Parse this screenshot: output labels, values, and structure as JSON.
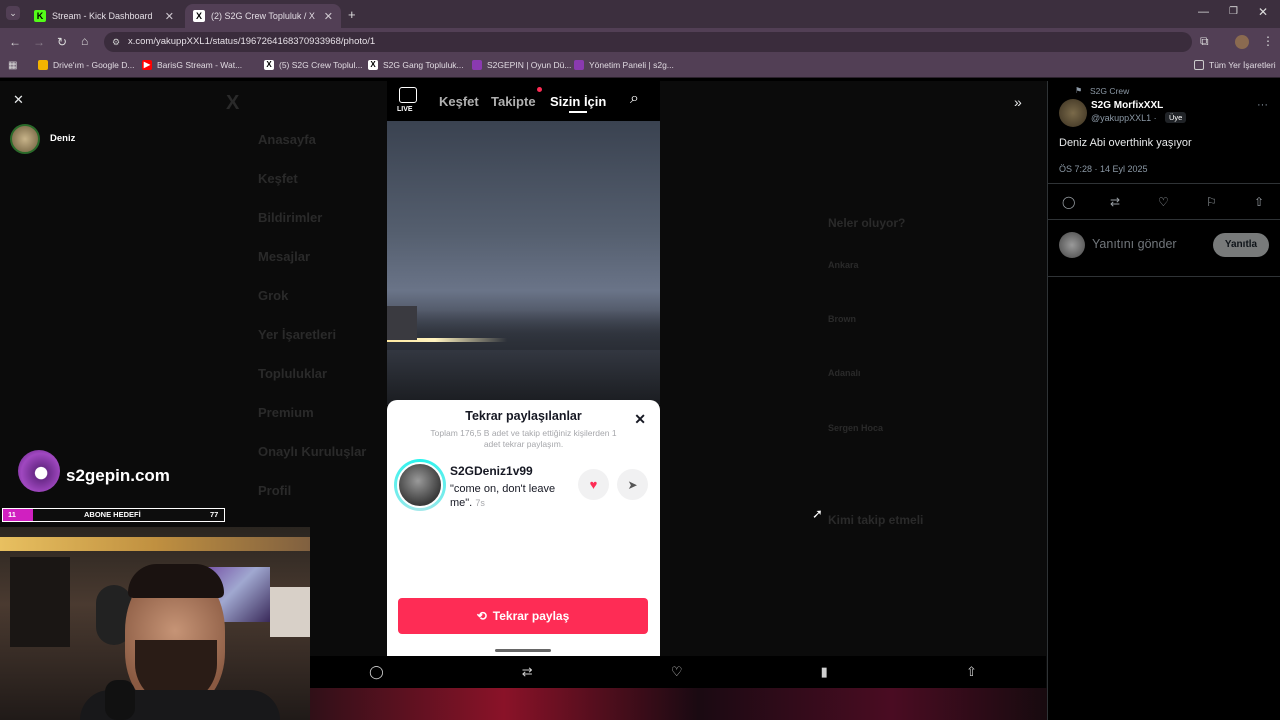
{
  "browser": {
    "tabs": [
      {
        "title": "Stream - Kick Dashboard",
        "favicon": "K"
      },
      {
        "title": "(2) S2G Crew Topluluk / X",
        "favicon": "X"
      }
    ],
    "url": "x.com/yakuppXXL1/status/1967264168370933968/photo/1",
    "bookmarks": [
      "Drive'ım - Google D...",
      "BarisG Stream - Wat...",
      "(5) S2G Crew Toplul...",
      "S2G Gang Topluluk...",
      "S2GEPIN | Oyun Dü...",
      "Yönetim Paneli | s2g..."
    ],
    "all_bookmarks": "Tüm Yer İşaretleri"
  },
  "left_panel": {
    "user_name": "Deniz"
  },
  "ghost_nav": [
    "Anasayfa",
    "Keşfet",
    "Bildirimler",
    "Mesajlar",
    "Grok",
    "Yer İşaretleri",
    "Topluluklar",
    "Premium",
    "Onaylı Kuruluşlar",
    "Profil"
  ],
  "ghost_right": {
    "trends_title": "Neler oluyor?",
    "trends": [
      "Ankara",
      "Brown",
      "Adanalı",
      "Sergen Hoca"
    ],
    "follow_title": "Kimi takip etmeli"
  },
  "tiktok": {
    "nav": {
      "live": "LIVE",
      "explore": "Keşfet",
      "following": "Takipte",
      "for_you": "Sizin İçin"
    },
    "sheet": {
      "title": "Tekrar paylaşılanlar",
      "subtitle": "Toplam 176,5 B adet ve takip ettiğiniz kişilerden 1 adet tekrar paylaşım.",
      "username": "S2GDeniz1v99",
      "quote": "\"come on, don't leave me\".",
      "time": "7s",
      "repost_button": "Tekrar paylaş"
    }
  },
  "tweet": {
    "community": "S2G Crew",
    "author": "S2G MorfixXXL",
    "handle": "@yakuppXXL1 ·",
    "badge": "Üye",
    "text": "Deniz Abi overthink yaşıyor",
    "time": "ÖS 7:28 · 14 Eyl 2025",
    "reply_placeholder": "Yanıtını gönder",
    "reply_button": "Yanıtla"
  },
  "overlay": {
    "brand": "s2gepin.com",
    "goal_label": "ABONE HEDEFİ",
    "goal_current": "11",
    "goal_target": "77"
  },
  "colors": {
    "accent_pink": "#fe2c55",
    "kick_green": "#53fc18",
    "tab_bg": "#3c2f3e"
  }
}
